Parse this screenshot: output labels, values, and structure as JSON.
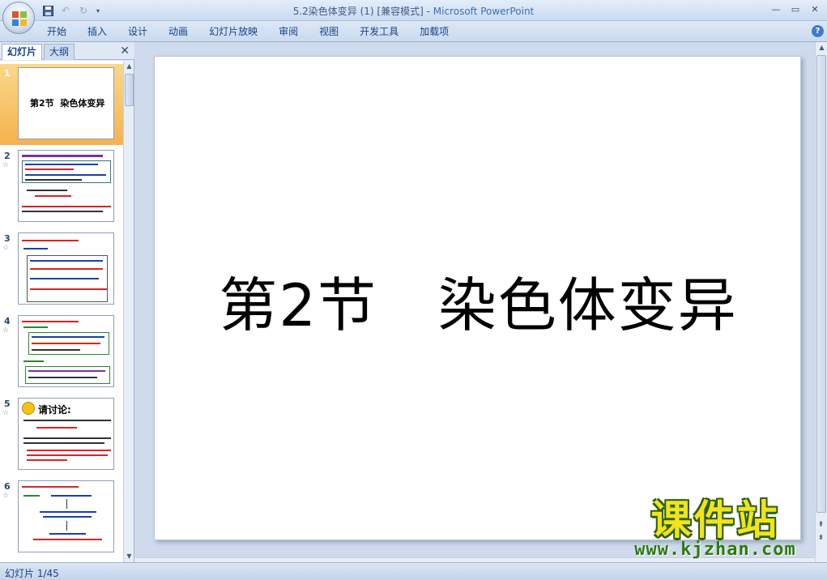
{
  "window": {
    "title": "5.2染色体变异 (1) [兼容模式] - ",
    "app": "Microsoft PowerPoint"
  },
  "qat": {
    "save_icon": "save-icon",
    "undo_icon": "undo-icon",
    "redo_icon": "redo-icon"
  },
  "ribbon": {
    "tabs": [
      "开始",
      "插入",
      "设计",
      "动画",
      "幻灯片放映",
      "审阅",
      "视图",
      "开发工具",
      "加载项"
    ]
  },
  "pane": {
    "tab_slides": "幻灯片",
    "tab_outline": "大纲"
  },
  "slides": [
    {
      "num": "1",
      "title": "第2节  染色体变异"
    },
    {
      "num": "2"
    },
    {
      "num": "3"
    },
    {
      "num": "4"
    },
    {
      "num": "5",
      "heading": "请讨论:"
    },
    {
      "num": "6"
    }
  ],
  "main_slide": {
    "title": "第2节   染色体变异"
  },
  "status": {
    "slide_counter": "幻灯片 1/45"
  },
  "watermark": {
    "cn": "课件站",
    "url": "www.kjzhan.com"
  },
  "colors": {
    "accent": "#15428b",
    "selected_slide": "#f5b24e",
    "watermark_yellow": "#f2e31c",
    "watermark_green": "#2e7a0e"
  }
}
